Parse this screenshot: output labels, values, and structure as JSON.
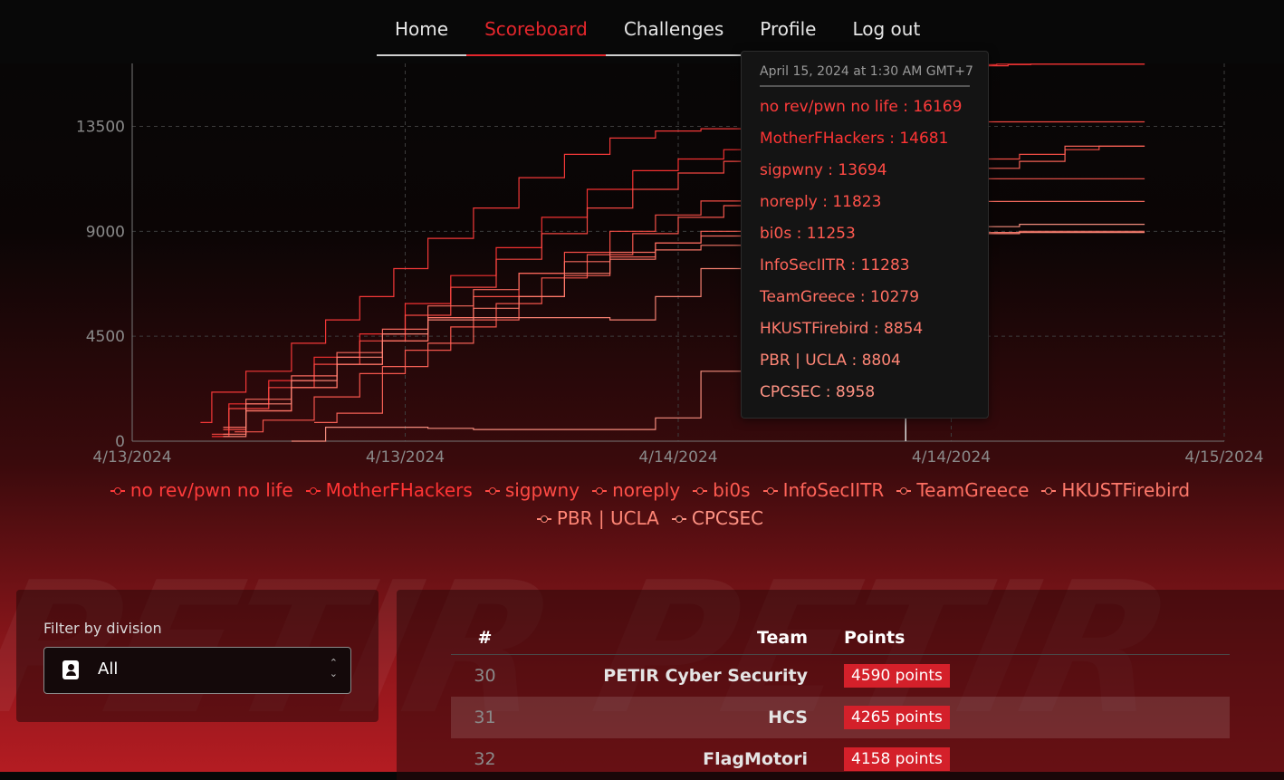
{
  "nav": {
    "items": [
      {
        "label": "Home"
      },
      {
        "label": "Scoreboard"
      },
      {
        "label": "Challenges"
      },
      {
        "label": "Profile"
      },
      {
        "label": "Log out"
      }
    ],
    "active": "Scoreboard"
  },
  "background_text": "PETIR PETIR",
  "chart_data": {
    "type": "line",
    "y_ticks": [
      "0",
      "4500",
      "9000",
      "13500"
    ],
    "ylim": [
      0,
      16200
    ],
    "x_ticks": [
      "4/13/2024",
      "4/13/2024",
      "4/14/2024",
      "4/14/2024",
      "4/15/2024"
    ],
    "xlim": [
      0,
      48
    ],
    "x_unit": "hours since first tick (4/13/2024)",
    "grid": true,
    "legend_position": "bottom",
    "hover_x": 34,
    "series": [
      {
        "name": "no rev/pwn no life",
        "color": "#ff3b3b",
        "x": [
          3,
          4,
          6,
          8,
          9,
          11,
          12,
          14,
          16,
          18,
          20,
          22,
          24,
          26,
          28,
          30,
          32,
          33,
          34,
          35,
          36,
          37,
          38,
          39,
          40,
          41,
          42,
          44.5
        ],
        "y": [
          800,
          2100,
          3000,
          4200,
          5200,
          6200,
          7400,
          8700,
          10000,
          11300,
          12300,
          13000,
          13300,
          13400,
          13450,
          13500,
          13600,
          14500,
          15600,
          15800,
          15950,
          16050,
          16100,
          16150,
          16169,
          16169,
          16169,
          16169
        ]
      },
      {
        "name": "MotherFHackers",
        "color": "#ff3434",
        "x": [
          3.5,
          5,
          7,
          9,
          11,
          13,
          15,
          17,
          19,
          21,
          23,
          25,
          27,
          29,
          31,
          33,
          34,
          35,
          36,
          37,
          39,
          41,
          44.5
        ],
        "y": [
          200,
          1600,
          2600,
          3600,
          4600,
          5900,
          7100,
          8300,
          9600,
          10800,
          11600,
          12100,
          12500,
          12800,
          13100,
          13600,
          14681,
          15500,
          15900,
          16150,
          16169,
          16169,
          16169
        ]
      },
      {
        "name": "sigpwny",
        "color": "#ff4a44",
        "x": [
          3.5,
          5,
          7,
          9,
          11,
          13,
          15,
          17,
          19,
          21,
          23,
          25,
          27,
          29,
          31,
          33,
          35,
          37,
          40,
          44.5
        ],
        "y": [
          300,
          1400,
          2300,
          3300,
          4300,
          5400,
          6600,
          7800,
          8900,
          10000,
          10800,
          11500,
          12000,
          12300,
          12700,
          13300,
          13694,
          13694,
          13694,
          13694
        ]
      },
      {
        "name": "noreply",
        "color": "#ff5149",
        "x": [
          4,
          6,
          8,
          10,
          12,
          14,
          16,
          18,
          20,
          22,
          24,
          26,
          28,
          30,
          32,
          34,
          36,
          38,
          40,
          42,
          43,
          44.5
        ],
        "y": [
          500,
          1300,
          2300,
          3300,
          4300,
          5300,
          6200,
          7200,
          8100,
          9000,
          9700,
          10300,
          10800,
          11100,
          11400,
          11823,
          11950,
          12100,
          12300,
          12500,
          12650,
          12650
        ]
      },
      {
        "name": "bi0s",
        "color": "#ff5a50",
        "x": [
          4.5,
          7,
          9,
          11,
          13,
          15,
          17,
          19,
          21,
          23,
          25,
          27,
          29,
          31,
          33,
          34,
          36,
          40,
          44.5
        ],
        "y": [
          400,
          900,
          1900,
          2900,
          3900,
          4900,
          5900,
          7000,
          8000,
          8900,
          9600,
          10100,
          10500,
          10800,
          11000,
          11253,
          11253,
          11253,
          11253
        ]
      },
      {
        "name": "InfoSecIITR",
        "color": "#ff655a",
        "x": [
          8,
          10,
          12,
          14,
          16,
          18,
          20,
          22,
          24,
          26,
          28,
          30,
          32,
          34,
          36,
          38,
          40,
          42,
          44.5
        ],
        "y": [
          800,
          1200,
          3200,
          4200,
          5200,
          6200,
          7100,
          7900,
          8500,
          9000,
          9500,
          9900,
          10300,
          11283,
          11500,
          11700,
          12000,
          12650,
          12650
        ]
      },
      {
        "name": "TeamGreece",
        "color": "#ff6f62",
        "x": [
          4,
          6,
          8,
          10,
          12,
          14,
          16,
          18,
          20,
          22,
          24,
          26,
          28,
          30,
          32,
          34,
          36,
          38,
          40,
          44.5
        ],
        "y": [
          600,
          1800,
          2800,
          3800,
          4800,
          5800,
          6500,
          7200,
          7700,
          8100,
          8500,
          8800,
          9100,
          9400,
          9700,
          10279,
          10279,
          10279,
          10279,
          10279
        ]
      },
      {
        "name": "HKUSTFirebird",
        "color": "#ff7a6c",
        "x": [
          4,
          6,
          8,
          10,
          12,
          14,
          16,
          18,
          20,
          22,
          24,
          26,
          28,
          30,
          32,
          34,
          36,
          38,
          40,
          44.5
        ],
        "y": [
          300,
          1300,
          2300,
          3300,
          4300,
          5300,
          5700,
          6200,
          7200,
          7800,
          8200,
          8400,
          8600,
          8700,
          8800,
          8854,
          8900,
          8950,
          9000,
          9000
        ]
      },
      {
        "name": "PBR | UCLA",
        "color": "#ff8676",
        "x": [
          4,
          6,
          8,
          10,
          12,
          14,
          16,
          18,
          20,
          22,
          24,
          26,
          28,
          30,
          32,
          34,
          36,
          38,
          40,
          44.5
        ],
        "y": [
          200,
          1600,
          2600,
          3600,
          4600,
          5200,
          5300,
          5300,
          5300,
          5200,
          6200,
          7400,
          8400,
          8700,
          8750,
          8804,
          8850,
          8900,
          8950,
          8950
        ]
      },
      {
        "name": "CPCSEC",
        "color": "#ff9384",
        "x": [
          7,
          10,
          12,
          14,
          16,
          18,
          20,
          22,
          24,
          26,
          28,
          30,
          32,
          34,
          36,
          38,
          40,
          44.5
        ],
        "y": [
          0,
          600,
          600,
          550,
          500,
          500,
          500,
          500,
          1000,
          3000,
          4400,
          5500,
          6200,
          8958,
          9100,
          9200,
          9300,
          9300
        ]
      }
    ]
  },
  "tooltip": {
    "date": "April 15, 2024 at 1:30 AM GMT+7",
    "entries": [
      "no rev/pwn no life : 16169",
      "MotherFHackers : 14681",
      "sigpwny : 13694",
      "noreply : 11823",
      "bi0s : 11253",
      "InfoSecIITR : 11283",
      "TeamGreece : 10279",
      "HKUSTFirebird : 8854",
      "PBR | UCLA : 8804",
      "CPCSEC : 8958"
    ]
  },
  "filter": {
    "label": "Filter by division",
    "value": "All",
    "icon": "contact-card-icon"
  },
  "table": {
    "headers": {
      "rank": "#",
      "team": "Team",
      "points": "Points"
    },
    "rows": [
      {
        "rank": "30",
        "team": "PETIR Cyber Security",
        "points": "4590 points"
      },
      {
        "rank": "31",
        "team": "HCS",
        "points": "4265 points"
      },
      {
        "rank": "32",
        "team": "FlagMotori",
        "points": "4158 points"
      }
    ]
  },
  "colors": {
    "accent": "#e3262c",
    "badge": "#d4202a"
  }
}
